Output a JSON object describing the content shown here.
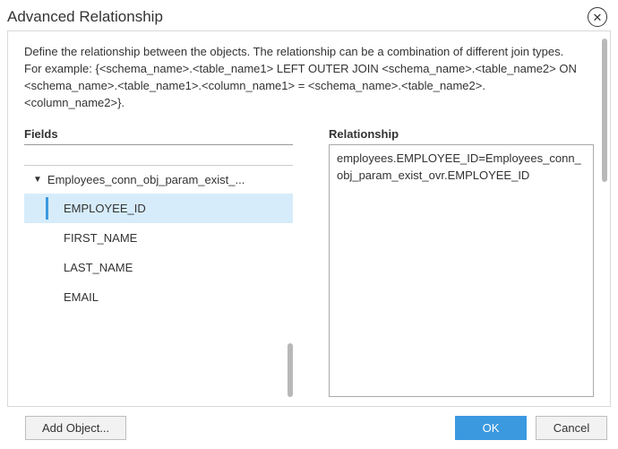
{
  "title": "Advanced Relationship",
  "description": "Define the relationship between the objects. The relationship can be a combination of different join types.\nFor example: {<schema_name>.<table_name1> LEFT OUTER JOIN <schema_name>.<table_name2> ON <schema_name>.<table_name1>.<column_name1> = <schema_name>.<table_name2>.<column_name2>}.",
  "fields": {
    "label": "Fields",
    "group": "Employees_conn_obj_param_exist_...",
    "items": [
      "EMPLOYEE_ID",
      "FIRST_NAME",
      "LAST_NAME",
      "EMAIL"
    ],
    "selected_index": 0
  },
  "relationship": {
    "label": "Relationship",
    "value": "employees.EMPLOYEE_ID=Employees_conn_obj_param_exist_ovr.EMPLOYEE_ID"
  },
  "buttons": {
    "add_object": "Add Object...",
    "ok": "OK",
    "cancel": "Cancel"
  }
}
